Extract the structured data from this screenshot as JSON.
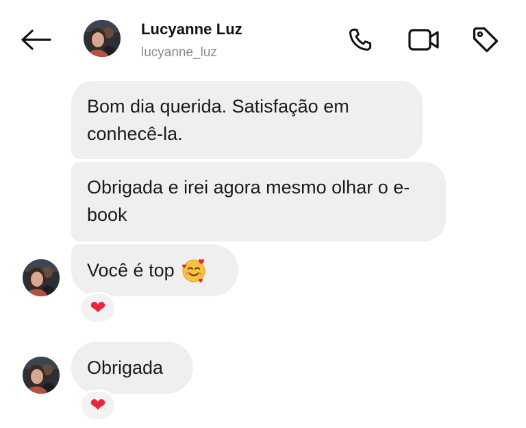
{
  "header": {
    "name": "Lucyanne Luz",
    "handle": "lucyanne_luz",
    "icons": {
      "back": "arrow-left-icon",
      "call": "phone-icon",
      "video": "video-camera-icon",
      "tag": "tag-icon"
    }
  },
  "messages": [
    {
      "text": "Bom dia querida. Satisfação em conhecê-la."
    },
    {
      "text": "Obrigada e irei agora mesmo olhar o e-book"
    },
    {
      "text": "Você é top",
      "emoji": "smiling-face-with-hearts",
      "reaction": "❤"
    },
    {
      "text": "Obrigada",
      "reaction": "❤"
    }
  ],
  "colors": {
    "bubble": "#efefef",
    "heart": "#e8273d",
    "handle": "#8a8a8a"
  }
}
